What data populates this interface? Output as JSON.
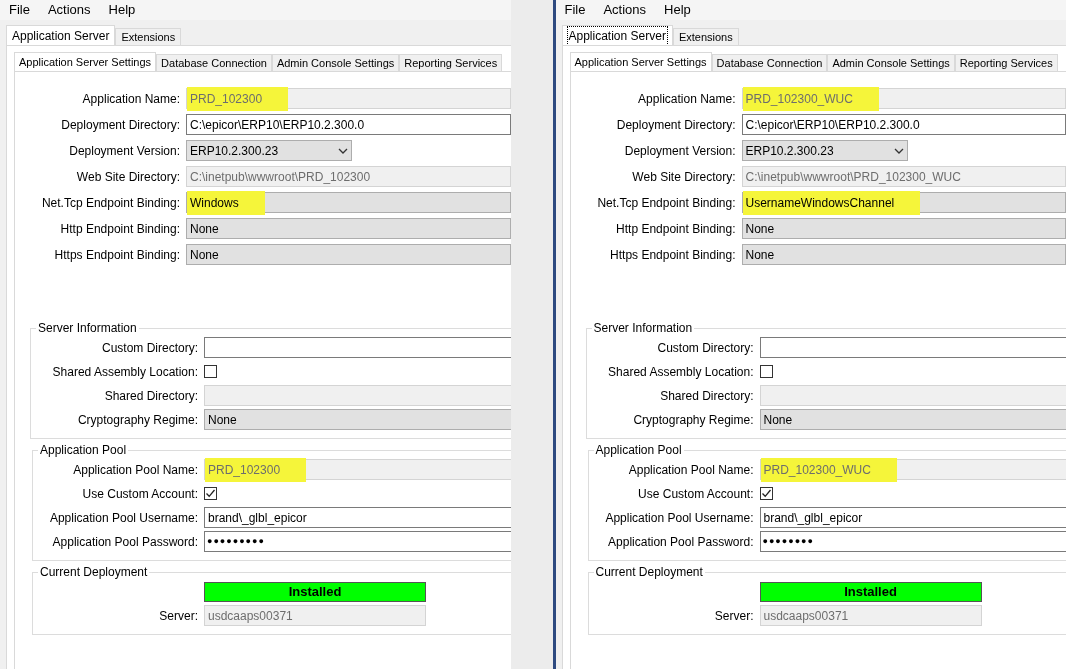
{
  "panels": [
    {
      "menu": [
        "File",
        "Actions",
        "Help"
      ],
      "outer_tabs": [
        {
          "label": "Application Server",
          "selected": true,
          "focused": false
        },
        {
          "label": "Extensions",
          "selected": false,
          "focused": false
        }
      ],
      "inner_tabs": [
        {
          "label": "Application Server Settings",
          "selected": true
        },
        {
          "label": "Database Connection",
          "selected": false
        },
        {
          "label": "Admin Console Settings",
          "selected": false
        },
        {
          "label": "Reporting Services",
          "selected": false
        }
      ],
      "fields": [
        {
          "label": "Application Name:",
          "value": "PRD_102300",
          "kind": "readonly",
          "highlighted": true
        },
        {
          "label": "Deployment Directory:",
          "value": "C:\\epicor\\ERP10\\ERP10.2.300.0",
          "kind": "text",
          "highlighted": false
        },
        {
          "label": "Deployment Version:",
          "value": "ERP10.2.300.23",
          "kind": "dropdown",
          "highlighted": false
        },
        {
          "label": "Web Site Directory:",
          "value": "C:\\inetpub\\wwwroot\\PRD_102300",
          "kind": "readonly",
          "highlighted": false
        },
        {
          "label": "Net.Tcp Endpoint Binding:",
          "value": "Windows",
          "kind": "select",
          "highlighted": true
        },
        {
          "label": "Http Endpoint Binding:",
          "value": "None",
          "kind": "select",
          "highlighted": false
        },
        {
          "label": "Https Endpoint Binding:",
          "value": "None",
          "kind": "select",
          "highlighted": false
        }
      ],
      "groups": [
        {
          "title": "Server Information",
          "fields": [
            {
              "label": "Custom Directory:",
              "kind": "text"
            },
            {
              "label": "Shared Assembly Location:",
              "checked": false,
              "kind": "checkbox"
            },
            {
              "label": "Shared Directory:",
              "kind": "readonly"
            },
            {
              "label": "Cryptography Regime:",
              "value": "None",
              "kind": "select",
              "highlighted": false
            }
          ]
        },
        {
          "title": "Application Pool",
          "fields": [
            {
              "label": "Application Pool Name:",
              "value": "PRD_102300",
              "kind": "readonly",
              "highlighted": true
            },
            {
              "label": "Use Custom Account:",
              "checked": true,
              "kind": "checkbox"
            },
            {
              "label": "Application Pool Username:",
              "value": "brand\\_glbl_epicor",
              "kind": "text",
              "highlighted": false
            },
            {
              "label": "Application Pool Password:",
              "value": "●●●●●●●●●",
              "kind": "password",
              "highlighted": false
            }
          ]
        },
        {
          "title": "Current Deployment",
          "fields": [
            {
              "value": "Installed",
              "kind": "status",
              "color": "#00ff00"
            },
            {
              "label": "Server:",
              "value": "usdcaaps00371",
              "kind": "short-readonly",
              "highlighted": false
            }
          ]
        }
      ]
    },
    {
      "menu": [
        "File",
        "Actions",
        "Help"
      ],
      "outer_tabs": [
        {
          "label": "Application Server",
          "selected": true,
          "focused": true
        },
        {
          "label": "Extensions",
          "selected": false,
          "focused": false
        }
      ],
      "inner_tabs": [
        {
          "label": "Application Server Settings",
          "selected": true
        },
        {
          "label": "Database Connection",
          "selected": false
        },
        {
          "label": "Admin Console Settings",
          "selected": false
        },
        {
          "label": "Reporting Services",
          "selected": false
        }
      ],
      "fields": [
        {
          "label": "Application Name:",
          "value": "PRD_102300_WUC",
          "kind": "readonly",
          "highlighted": true
        },
        {
          "label": "Deployment Directory:",
          "value": "C:\\epicor\\ERP10\\ERP10.2.300.0",
          "kind": "text",
          "highlighted": false
        },
        {
          "label": "Deployment Version:",
          "value": "ERP10.2.300.23",
          "kind": "dropdown",
          "highlighted": false
        },
        {
          "label": "Web Site Directory:",
          "value": "C:\\inetpub\\wwwroot\\PRD_102300_WUC",
          "kind": "readonly",
          "highlighted": false
        },
        {
          "label": "Net.Tcp Endpoint Binding:",
          "value": "UsernameWindowsChannel",
          "kind": "select",
          "highlighted": true
        },
        {
          "label": "Http Endpoint Binding:",
          "value": "None",
          "kind": "select",
          "highlighted": false
        },
        {
          "label": "Https Endpoint Binding:",
          "value": "None",
          "kind": "select",
          "highlighted": false
        }
      ],
      "groups": [
        {
          "title": "Server Information",
          "fields": [
            {
              "label": "Custom Directory:",
              "kind": "text"
            },
            {
              "label": "Shared Assembly Location:",
              "checked": false,
              "kind": "checkbox"
            },
            {
              "label": "Shared Directory:",
              "kind": "readonly"
            },
            {
              "label": "Cryptography Regime:",
              "value": "None",
              "kind": "select",
              "highlighted": false
            }
          ]
        },
        {
          "title": "Application Pool",
          "fields": [
            {
              "label": "Application Pool Name:",
              "value": "PRD_102300_WUC",
              "kind": "readonly",
              "highlighted": true
            },
            {
              "label": "Use Custom Account:",
              "checked": true,
              "kind": "checkbox"
            },
            {
              "label": "Application Pool Username:",
              "value": "brand\\_glbl_epicor",
              "kind": "text",
              "highlighted": false
            },
            {
              "label": "Application Pool Password:",
              "value": "●●●●●●●●",
              "kind": "password",
              "highlighted": false
            }
          ]
        },
        {
          "title": "Current Deployment",
          "fields": [
            {
              "value": "Installed",
              "kind": "status",
              "color": "#00ff00"
            },
            {
              "label": "Server:",
              "value": "usdcaaps00371",
              "kind": "short-readonly",
              "highlighted": false
            }
          ]
        }
      ]
    }
  ]
}
